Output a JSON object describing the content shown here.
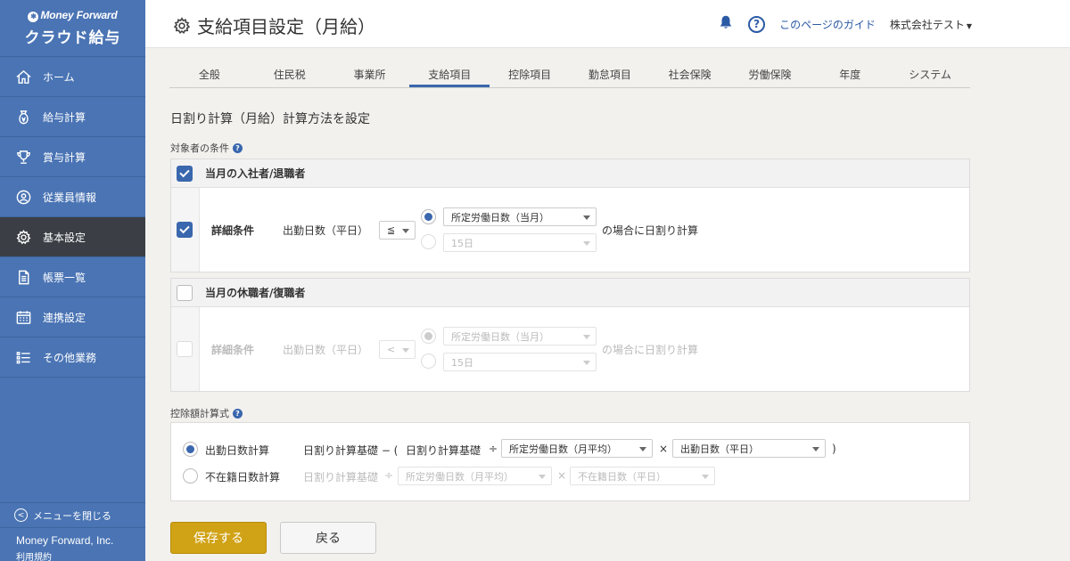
{
  "brand": {
    "line1": "Money Forward",
    "line2": "クラウド給与"
  },
  "sidebar": {
    "items": [
      {
        "label": "ホーム",
        "icon": "home-icon"
      },
      {
        "label": "給与計算",
        "icon": "money-bag-icon"
      },
      {
        "label": "賞与計算",
        "icon": "trophy-icon"
      },
      {
        "label": "従業員情報",
        "icon": "id-badge-icon"
      },
      {
        "label": "基本設定",
        "icon": "gear-icon",
        "active": true
      },
      {
        "label": "帳票一覧",
        "icon": "document-icon"
      },
      {
        "label": "連携設定",
        "icon": "calendar-icon"
      },
      {
        "label": "その他業務",
        "icon": "list-icon"
      }
    ],
    "close_menu": "メニューを閉じる",
    "company": "Money Forward, Inc.",
    "terms": "利用規約"
  },
  "header": {
    "title": "支給項目設定（月給）",
    "guide": "このページのガイド",
    "company": "株式会社テスト",
    "help": "?"
  },
  "tabs": [
    "全般",
    "住民税",
    "事業所",
    "支給項目",
    "控除項目",
    "勤怠項目",
    "社会保険",
    "労働保険",
    "年度",
    "システム"
  ],
  "active_tab": 3,
  "main": {
    "section_title": "日割り計算（月給）計算方法を設定",
    "target_label": "対象者の条件",
    "panel1": {
      "title": "当月の入社者/退職者",
      "checked": true,
      "detail_label": "詳細条件",
      "detail_checked": true,
      "attendance": "出勤日数（平日）",
      "operator": "≦",
      "option1": "所定労働日数（当月）",
      "option2": "15日",
      "suffix": "の場合に日割り計算"
    },
    "panel2": {
      "title": "当月の休職者/復職者",
      "checked": false,
      "detail_label": "詳細条件",
      "detail_checked": false,
      "attendance": "出勤日数（平日）",
      "operator": "<",
      "option1": "所定労働日数（当月）",
      "option2": "15日",
      "suffix": "の場合に日割り計算"
    },
    "deduction_label": "控除額計算式",
    "formula1": {
      "label": "出勤日数計算",
      "base": "日割り計算基礎 − (",
      "base2": "日割り計算基礎",
      "div": "÷",
      "sel1": "所定労働日数（月平均）",
      "times": "×",
      "sel2": "出勤日数（平日）",
      "close": ")"
    },
    "formula2": {
      "label": "不在籍日数計算",
      "base": "日割り計算基礎",
      "div": "÷",
      "sel1": "所定労働日数（月平均）",
      "times": "×",
      "sel2": "不在籍日数（平日）"
    }
  },
  "buttons": {
    "save": "保存する",
    "back": "戻る"
  },
  "colors": {
    "sidebar": "#4a74b4",
    "active_nav": "#3b3f45",
    "primary": "#3a67ad",
    "save": "#d0a215"
  }
}
